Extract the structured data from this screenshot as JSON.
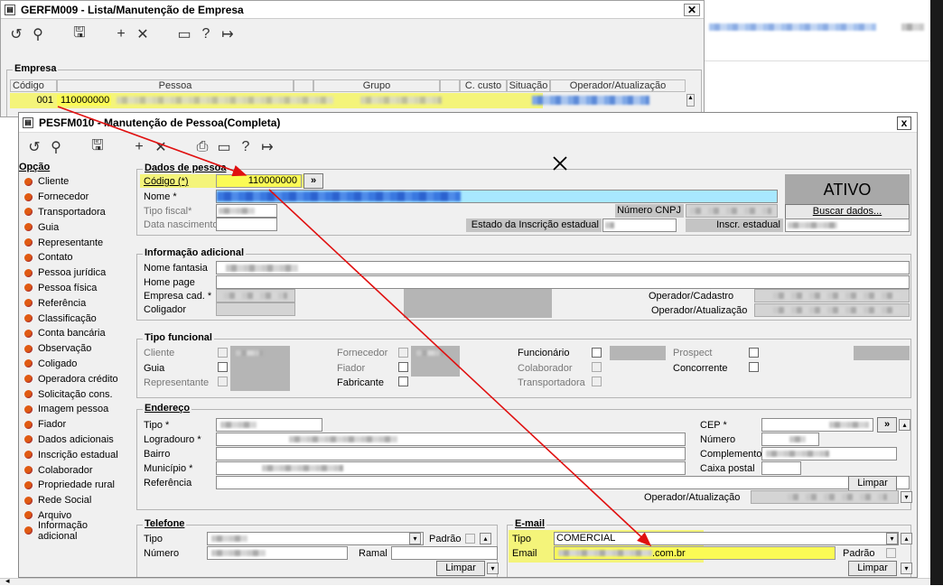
{
  "win1": {
    "title": "GERFM009 - Lista/Manutenção de Empresa",
    "close": "✕",
    "group": "Empresa",
    "columns": [
      "Código",
      "Pessoa",
      "",
      "Grupo",
      "",
      "C. custo",
      "Situação",
      "Operador/Atualização"
    ],
    "row": {
      "code": "001",
      "pessoa": "110000000"
    }
  },
  "bg_right": {
    "text": "...."
  },
  "win2": {
    "title": "PESFM010 - Manutenção de Pessoa(Completa)",
    "close": "x"
  },
  "sidebar": {
    "title": "Opção",
    "items": [
      "Cliente",
      "Fornecedor",
      "Transportadora",
      "Guia",
      "Representante",
      "Contato",
      "Pessoa jurídica",
      "Pessoa física",
      "Referência",
      "Classificação",
      "Conta bancária",
      "Observação",
      "Coligado",
      "Operadora crédito",
      "Solicitação cons.",
      "Imagem pessoa",
      "Fiador",
      "Dados adicionais",
      "Inscrição estadual",
      "Colaborador",
      "Propriedade rural",
      "Rede Social",
      "Arquivo",
      "Informação adicional"
    ]
  },
  "dados": {
    "title": "Dados de pessoa",
    "codigo_label": "Código (*)",
    "codigo_value": "110000000",
    "lookup": "»",
    "nome_label": "Nome *",
    "tipo_fiscal_label": "Tipo fiscal*",
    "data_nasc_label": "Data nascimento",
    "status": "ATIVO",
    "numero_cnpj": "Número CNPJ",
    "buscar": "Buscar dados...",
    "estado_ie": "Estado da Inscrição estadual",
    "inscr_estadual": "Inscr. estadual"
  },
  "info": {
    "title": "Informação adicional",
    "nome_fantasia": "Nome fantasia",
    "home_page": "Home page",
    "empresa_cad": "Empresa cad. *",
    "coligador": "Coligador",
    "op_cadastro": "Operador/Cadastro",
    "op_atualizacao": "Operador/Atualização"
  },
  "tipo": {
    "title": "Tipo funcional",
    "cliente": "Cliente",
    "guia": "Guia",
    "representante": "Representante",
    "fornecedor": "Fornecedor",
    "fiador": "Fiador",
    "fabricante": "Fabricante",
    "funcionario": "Funcionário",
    "colaborador": "Colaborador",
    "transportadora": "Transportadora",
    "prospect": "Prospect",
    "concorrente": "Concorrente"
  },
  "endereco": {
    "title": "Endereço",
    "tipo": "Tipo *",
    "logradouro": "Logradouro *",
    "bairro": "Bairro",
    "municipio": "Município *",
    "referencia": "Referência",
    "cep": "CEP *",
    "numero": "Número",
    "complemento": "Complemento",
    "caixa_postal": "Caixa postal",
    "limpar": "Limpar",
    "op_atualizacao": "Operador/Atualização"
  },
  "telefone": {
    "title": "Telefone",
    "tipo": "Tipo",
    "numero": "Número",
    "padrao": "Padrão",
    "ramal": "Ramal",
    "limpar": "Limpar"
  },
  "email": {
    "title": "E-mail",
    "tipo_label": "Tipo",
    "tipo_value": "COMERCIAL",
    "email_label": "Email",
    "email_suffix": ".com.br",
    "padrao": "Padrão",
    "limpar": "Limpar"
  },
  "colors": {
    "highlight": "#f4f47a",
    "arrow": "#e01010",
    "name_field": "#a8e8ff",
    "status_bg": "#a8a8a8"
  }
}
